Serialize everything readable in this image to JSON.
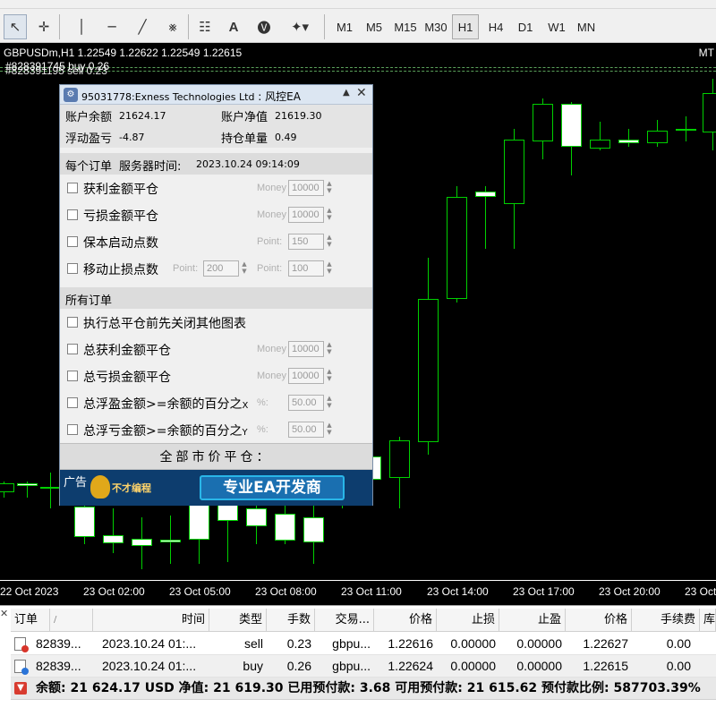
{
  "toolbar": {
    "timeframes": [
      {
        "label": "M1",
        "active": false
      },
      {
        "label": "M5",
        "active": false
      },
      {
        "label": "M15",
        "active": false
      },
      {
        "label": "M30",
        "active": false
      },
      {
        "label": "H1",
        "active": true
      },
      {
        "label": "H4",
        "active": false
      },
      {
        "label": "D1",
        "active": false
      },
      {
        "label": "W1",
        "active": false
      },
      {
        "label": "MN",
        "active": false
      }
    ],
    "text_tool_label": "A"
  },
  "chart": {
    "title": "GBPUSDm,H1  1.22549 1.22622 1.22549 1.22615",
    "corner_label": "MT",
    "order_lines": [
      {
        "label": "#828391745 buy 0.26"
      },
      {
        "label": "#828391195 sell 0.23"
      }
    ],
    "time_labels": [
      "22 Oct 2023",
      "23 Oct 02:00",
      "23 Oct 05:00",
      "23 Oct 08:00",
      "23 Oct 11:00",
      "23 Oct 14:00",
      "23 Oct 17:00",
      "23 Oct 20:00",
      "23 Oct"
    ],
    "colors": {
      "background": "#000000",
      "candle": "#00d000",
      "bear_body": "#ffffff"
    }
  },
  "ea_panel": {
    "title_account": "95031778:Exness Technologies Ltd",
    "title_sep": " : ",
    "title_name": "风控EA",
    "balance_label": "账户余额",
    "balance_value": "21624.17",
    "equity_label": "账户净值",
    "equity_value": "21619.30",
    "floating_label": "浮动盈亏",
    "floating_value": "-4.87",
    "lots_label": "持仓单量",
    "lots_value": "0.49",
    "per_order_head": "每个订单",
    "server_time_label": "服务器时间:",
    "server_time_value": "2023.10.24 09:14:09",
    "per_order_options": [
      {
        "label": "获利金额平仓",
        "field_caption": "Money",
        "value": "10000"
      },
      {
        "label": "亏损金额平仓",
        "field_caption": "Money",
        "value": "10000"
      },
      {
        "label": "保本启动点数",
        "field_caption": "Point:",
        "value": "150"
      }
    ],
    "trailing": {
      "label": "移动止损点数",
      "caption1": "Point:",
      "value1": "200",
      "caption2": "Point:",
      "value2": "100"
    },
    "all_orders_head": "所有订单",
    "all_options": [
      {
        "label": "执行总平仓前先关闭其他图表"
      },
      {
        "label": "总获利金额平仓",
        "field_caption": "Money",
        "value": "10000"
      },
      {
        "label": "总亏损金额平仓",
        "field_caption": "Money",
        "value": "10000"
      },
      {
        "label": "总浮盈金额>=余额的百分之",
        "suffix": "X",
        "field_caption": "%:",
        "value": "50.00"
      },
      {
        "label": "总浮亏金额>=余额的百分之",
        "suffix": "Y",
        "field_caption": "%:",
        "value": "50.00"
      }
    ],
    "close_all_label": "全部市价平仓：",
    "ad": {
      "label": "广告",
      "brand": "不才编程",
      "slogan": "专业EA开发商"
    }
  },
  "terminal": {
    "headers": [
      "订单",
      "/",
      "时间",
      "类型",
      "手数",
      "交易...",
      "价格",
      "止损",
      "止盈",
      "价格",
      "手续费",
      "库"
    ],
    "rows": [
      {
        "ticket": "82839...",
        "time": "2023.10.24 01:...",
        "type": "sell",
        "lots": "0.23",
        "symbol": "gbpu...",
        "open_price": "1.22616",
        "sl": "0.00000",
        "tp": "0.00000",
        "price": "1.22627",
        "commission": "0.00",
        "marker": "sell"
      },
      {
        "ticket": "82839...",
        "time": "2023.10.24 01:...",
        "type": "buy",
        "lots": "0.26",
        "symbol": "gbpu...",
        "open_price": "1.22624",
        "sl": "0.00000",
        "tp": "0.00000",
        "price": "1.22615",
        "commission": "0.00",
        "marker": "buy"
      }
    ],
    "balance_line": "余额: 21 624.17 USD  净值: 21 619.30  已用预付款: 3.68  可用预付款: 21 615.62  预付款比例: 587703.39%"
  }
}
